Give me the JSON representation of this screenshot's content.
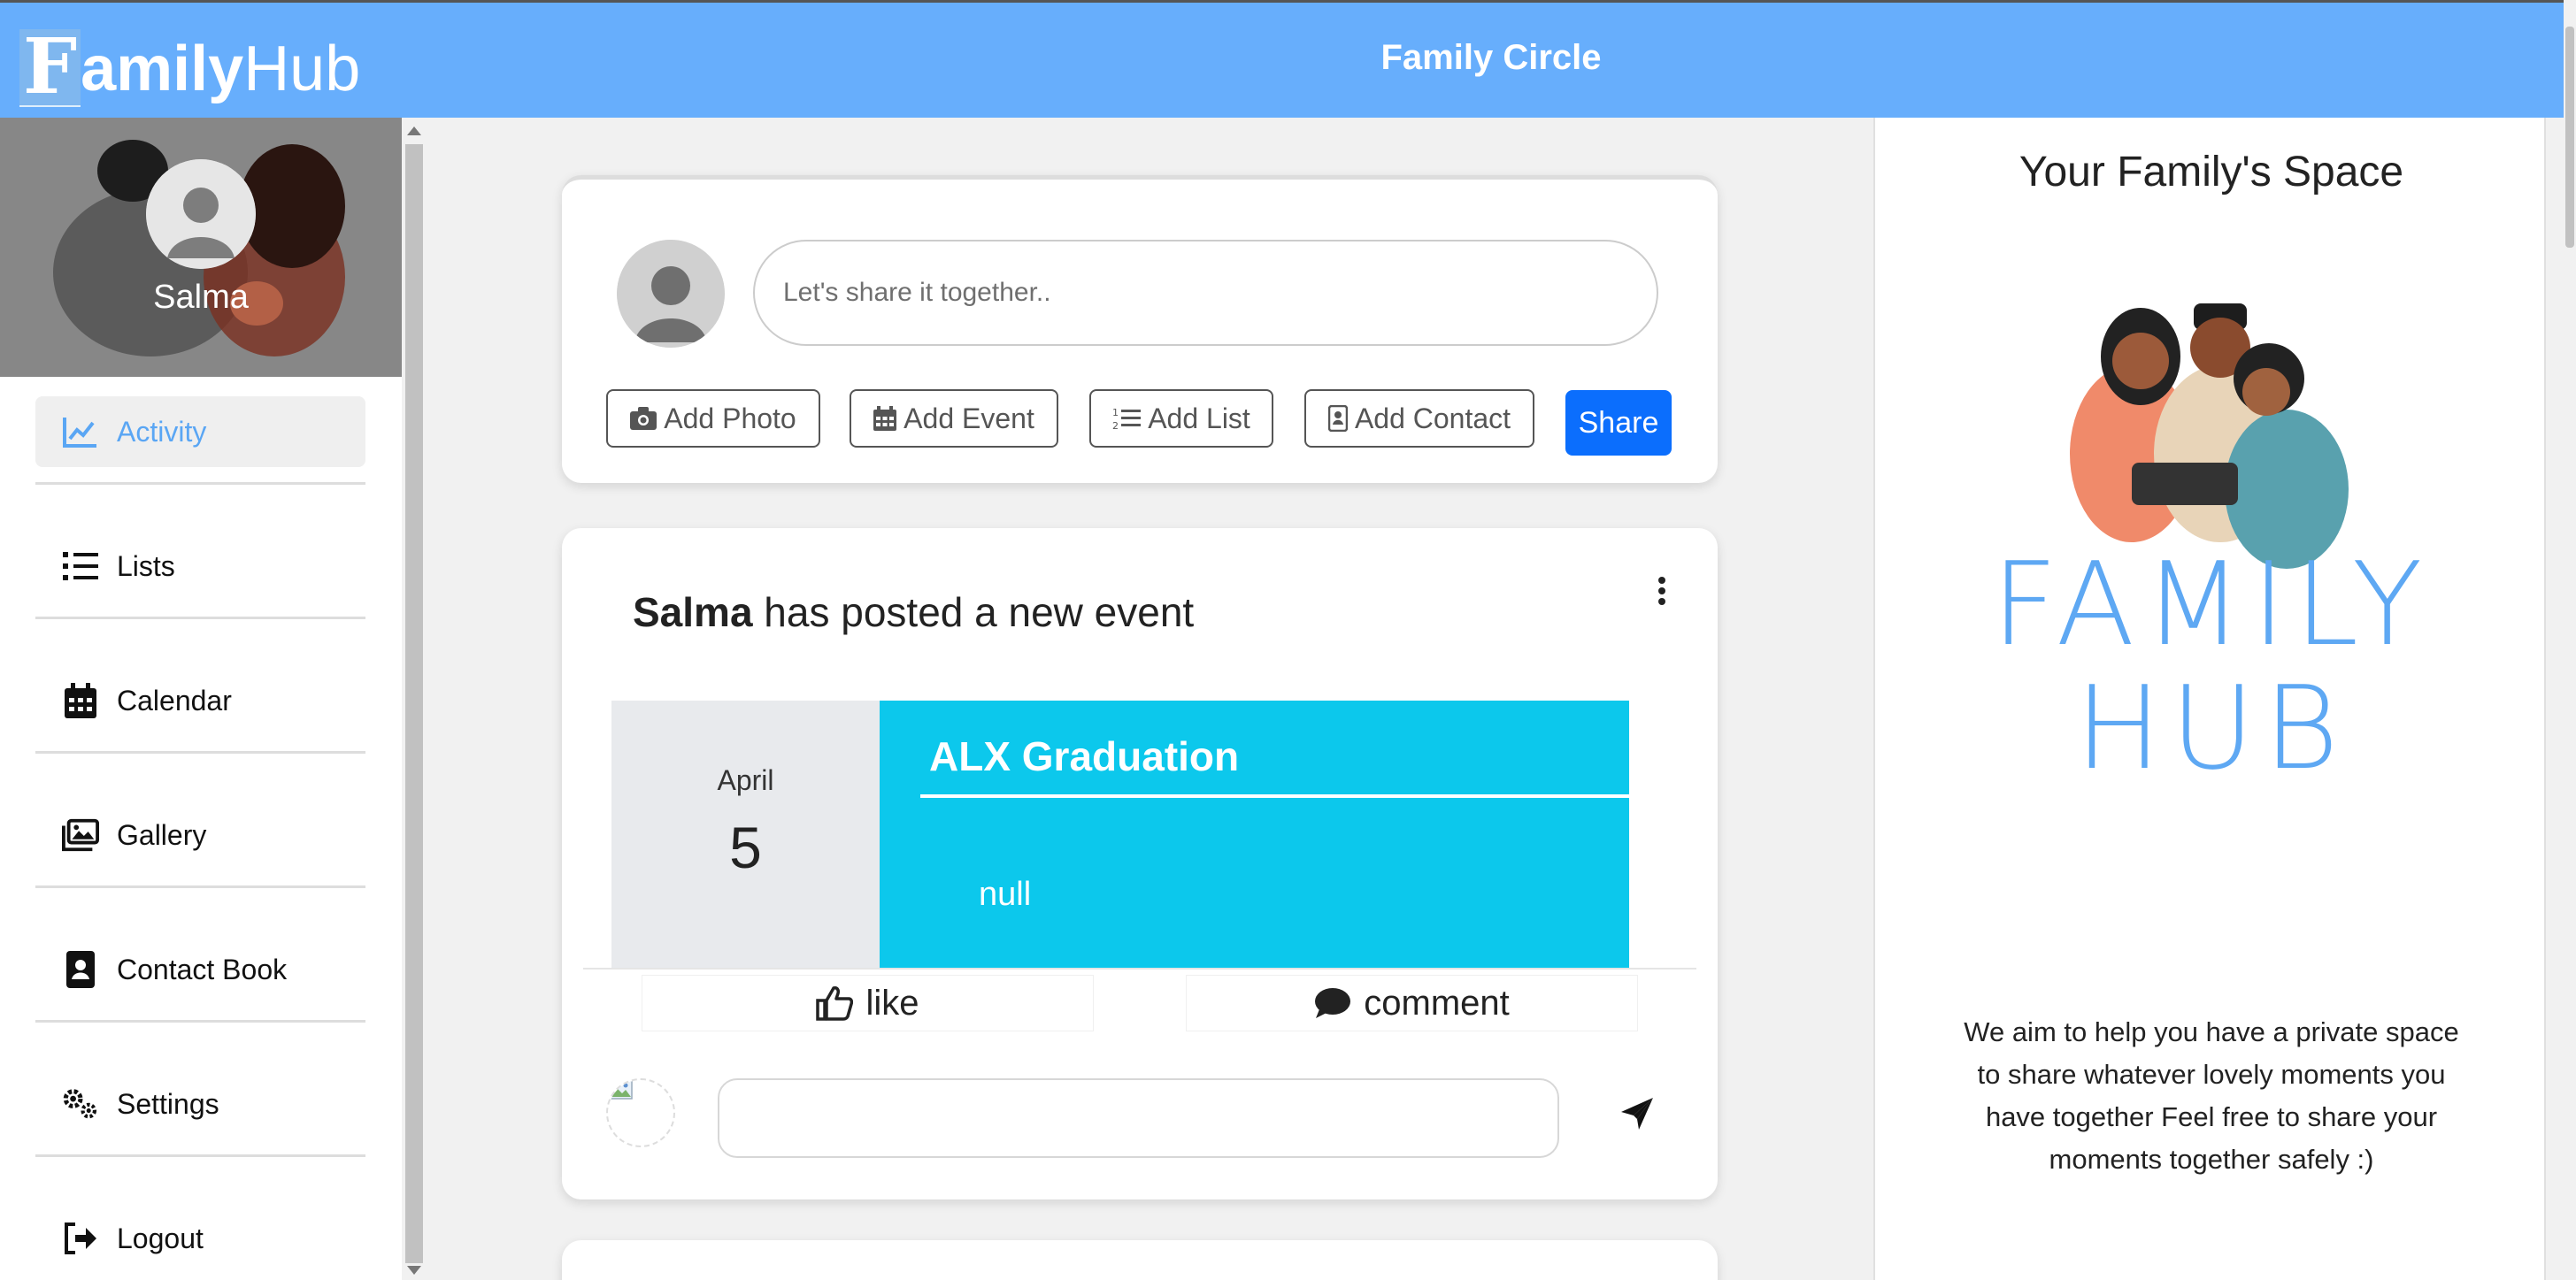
{
  "header": {
    "brand_initial": "F",
    "brand_bold": "amily",
    "brand_rest": "Hub",
    "title": "Family Circle"
  },
  "sidebar": {
    "profile_name": "Salma",
    "items": [
      {
        "label": "Activity",
        "icon": "chart-line-icon",
        "active": true
      },
      {
        "label": "Lists",
        "icon": "list-icon"
      },
      {
        "label": "Calendar",
        "icon": "calendar-icon"
      },
      {
        "label": "Gallery",
        "icon": "images-icon"
      },
      {
        "label": "Contact Book",
        "icon": "address-book-icon"
      },
      {
        "label": "Settings",
        "icon": "gears-icon"
      },
      {
        "label": "Logout",
        "icon": "logout-icon"
      }
    ]
  },
  "composer": {
    "placeholder": "Let's share it together..",
    "buttons": {
      "photo": "Add Photo",
      "event": "Add Event",
      "list": "Add List",
      "contact": "Add Contact"
    },
    "share": "Share"
  },
  "post": {
    "author": "Salma",
    "action": " has posted a new event",
    "event": {
      "month": "April",
      "day": "5",
      "title": "ALX Graduation",
      "description": "null"
    },
    "like": "like",
    "comment": "comment"
  },
  "right_panel": {
    "title": "Your Family's Space",
    "logo_line1": "FAMILY",
    "logo_line2": "HUB",
    "text": "We aim to help you have a private space to share whatever lovely moments you have together Feel free to share your moments together safely :)"
  },
  "colors": {
    "header": "#67aefc",
    "accent": "#0b6efd",
    "event": "#0cc8ec",
    "active_nav": "#5aa6f4"
  }
}
